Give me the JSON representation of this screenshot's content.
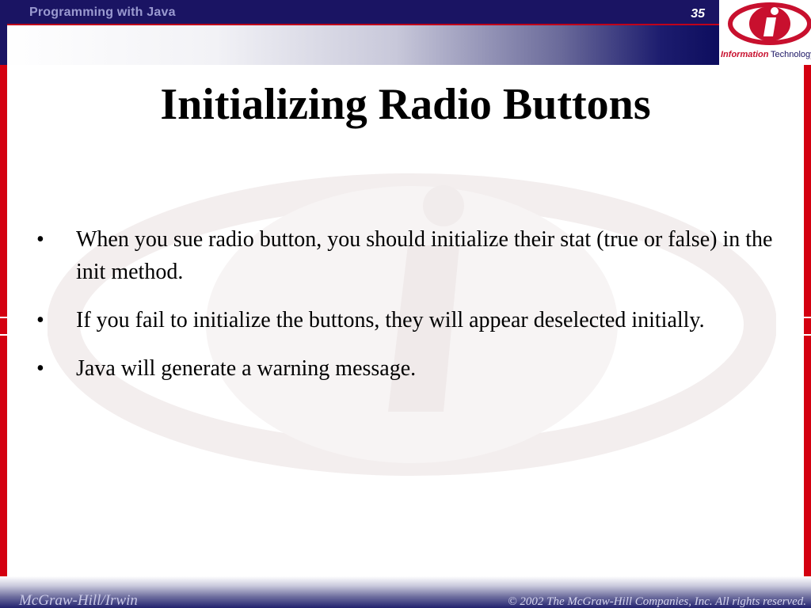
{
  "header": {
    "course_title": "Programming with Java",
    "slide_number": "35"
  },
  "logo": {
    "letter": "i",
    "text_part1": "Information",
    "text_part2": "Technology",
    "icon": "information-technology-logo-icon"
  },
  "slide": {
    "title": "Initializing Radio Buttons",
    "bullet_symbol": "•",
    "bullets": [
      "When you sue radio button, you should initialize their stat (true or false) in the init method.",
      "If you fail to initialize the buttons, they will appear deselected initially.",
      "Java will generate a warning message."
    ]
  },
  "footer": {
    "publisher": "McGraw-Hill/Irwin",
    "copyright": "© 2002  The McGraw-Hill Companies, Inc. All rights reserved."
  },
  "colors": {
    "header_navy": "#1a1463",
    "accent_red": "#d40010",
    "title_text": "#000000",
    "course_title_text": "#9a9ad0"
  }
}
